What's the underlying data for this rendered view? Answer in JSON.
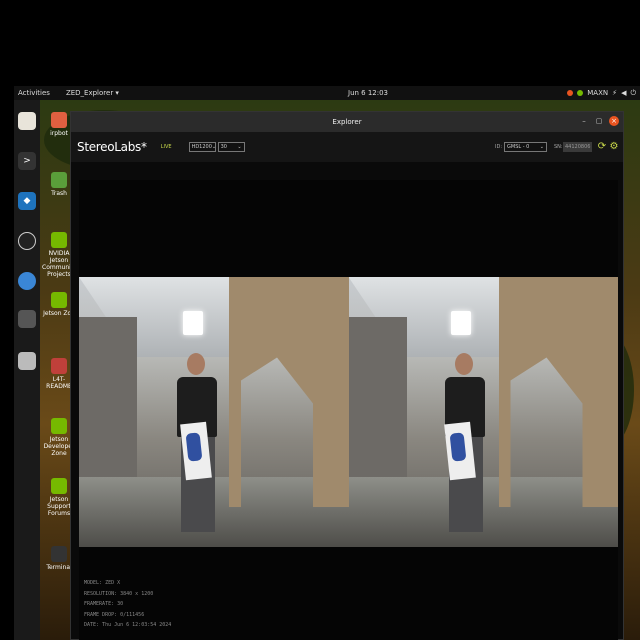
{
  "topbar": {
    "activities": "Activities",
    "app_menu": "ZED_Explorer ▾",
    "clock": "Jun 6 12:03",
    "power_mode": "MAXN"
  },
  "desktop": {
    "icons": [
      {
        "label": "irpbot"
      },
      {
        "label": "Trash"
      },
      {
        "label": "NVIDIA Jetson Community Projects"
      },
      {
        "label": "Jetson Zoo"
      },
      {
        "label": "L4T-README"
      },
      {
        "label": "Jetson Developer Zone"
      },
      {
        "label": "Jetson Support Forums"
      },
      {
        "label": "Terminal"
      }
    ]
  },
  "window": {
    "title": "Explorer",
    "minimize": "–",
    "maximize": "▢",
    "close": "×"
  },
  "toolbar": {
    "brand": "StereoLabs*",
    "live": "LIVE",
    "resolution": "HD1200",
    "fps": "30",
    "id_label": "ID:",
    "id_value": "GMSL - 0",
    "sn_label": "SN:",
    "sn_value": "44120806"
  },
  "info": {
    "model": "MODEL: ZED X",
    "resolution": "RESOLUTION: 3840 x 1200",
    "framerate": "FRAMERATE: 30",
    "frame_drop": "FRAME DROP: 0/111456",
    "date": "DATE: Thu Jun 6 12:03:54 2024"
  },
  "colors": {
    "accent": "#c8d84a",
    "close": "#e95420"
  }
}
